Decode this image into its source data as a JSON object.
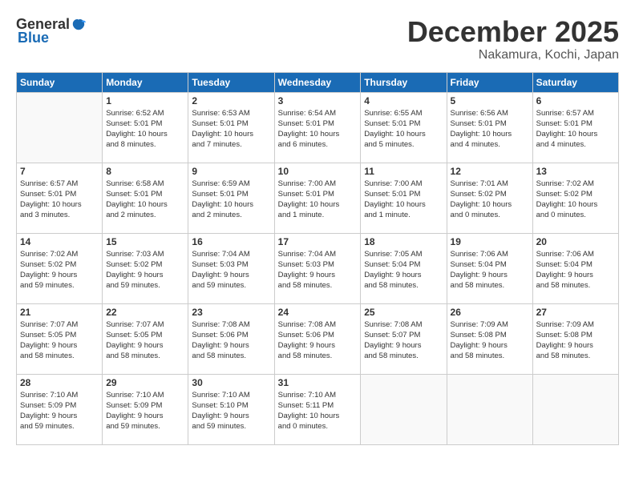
{
  "logo": {
    "general": "General",
    "blue": "Blue"
  },
  "header": {
    "month": "December 2025",
    "location": "Nakamura, Kochi, Japan"
  },
  "days_of_week": [
    "Sunday",
    "Monday",
    "Tuesday",
    "Wednesday",
    "Thursday",
    "Friday",
    "Saturday"
  ],
  "weeks": [
    [
      {
        "day": "",
        "info": ""
      },
      {
        "day": "1",
        "info": "Sunrise: 6:52 AM\nSunset: 5:01 PM\nDaylight: 10 hours\nand 8 minutes."
      },
      {
        "day": "2",
        "info": "Sunrise: 6:53 AM\nSunset: 5:01 PM\nDaylight: 10 hours\nand 7 minutes."
      },
      {
        "day": "3",
        "info": "Sunrise: 6:54 AM\nSunset: 5:01 PM\nDaylight: 10 hours\nand 6 minutes."
      },
      {
        "day": "4",
        "info": "Sunrise: 6:55 AM\nSunset: 5:01 PM\nDaylight: 10 hours\nand 5 minutes."
      },
      {
        "day": "5",
        "info": "Sunrise: 6:56 AM\nSunset: 5:01 PM\nDaylight: 10 hours\nand 4 minutes."
      },
      {
        "day": "6",
        "info": "Sunrise: 6:57 AM\nSunset: 5:01 PM\nDaylight: 10 hours\nand 4 minutes."
      }
    ],
    [
      {
        "day": "7",
        "info": "Sunrise: 6:57 AM\nSunset: 5:01 PM\nDaylight: 10 hours\nand 3 minutes."
      },
      {
        "day": "8",
        "info": "Sunrise: 6:58 AM\nSunset: 5:01 PM\nDaylight: 10 hours\nand 2 minutes."
      },
      {
        "day": "9",
        "info": "Sunrise: 6:59 AM\nSunset: 5:01 PM\nDaylight: 10 hours\nand 2 minutes."
      },
      {
        "day": "10",
        "info": "Sunrise: 7:00 AM\nSunset: 5:01 PM\nDaylight: 10 hours\nand 1 minute."
      },
      {
        "day": "11",
        "info": "Sunrise: 7:00 AM\nSunset: 5:01 PM\nDaylight: 10 hours\nand 1 minute."
      },
      {
        "day": "12",
        "info": "Sunrise: 7:01 AM\nSunset: 5:02 PM\nDaylight: 10 hours\nand 0 minutes."
      },
      {
        "day": "13",
        "info": "Sunrise: 7:02 AM\nSunset: 5:02 PM\nDaylight: 10 hours\nand 0 minutes."
      }
    ],
    [
      {
        "day": "14",
        "info": "Sunrise: 7:02 AM\nSunset: 5:02 PM\nDaylight: 9 hours\nand 59 minutes."
      },
      {
        "day": "15",
        "info": "Sunrise: 7:03 AM\nSunset: 5:02 PM\nDaylight: 9 hours\nand 59 minutes."
      },
      {
        "day": "16",
        "info": "Sunrise: 7:04 AM\nSunset: 5:03 PM\nDaylight: 9 hours\nand 59 minutes."
      },
      {
        "day": "17",
        "info": "Sunrise: 7:04 AM\nSunset: 5:03 PM\nDaylight: 9 hours\nand 58 minutes."
      },
      {
        "day": "18",
        "info": "Sunrise: 7:05 AM\nSunset: 5:04 PM\nDaylight: 9 hours\nand 58 minutes."
      },
      {
        "day": "19",
        "info": "Sunrise: 7:06 AM\nSunset: 5:04 PM\nDaylight: 9 hours\nand 58 minutes."
      },
      {
        "day": "20",
        "info": "Sunrise: 7:06 AM\nSunset: 5:04 PM\nDaylight: 9 hours\nand 58 minutes."
      }
    ],
    [
      {
        "day": "21",
        "info": "Sunrise: 7:07 AM\nSunset: 5:05 PM\nDaylight: 9 hours\nand 58 minutes."
      },
      {
        "day": "22",
        "info": "Sunrise: 7:07 AM\nSunset: 5:05 PM\nDaylight: 9 hours\nand 58 minutes."
      },
      {
        "day": "23",
        "info": "Sunrise: 7:08 AM\nSunset: 5:06 PM\nDaylight: 9 hours\nand 58 minutes."
      },
      {
        "day": "24",
        "info": "Sunrise: 7:08 AM\nSunset: 5:06 PM\nDaylight: 9 hours\nand 58 minutes."
      },
      {
        "day": "25",
        "info": "Sunrise: 7:08 AM\nSunset: 5:07 PM\nDaylight: 9 hours\nand 58 minutes."
      },
      {
        "day": "26",
        "info": "Sunrise: 7:09 AM\nSunset: 5:08 PM\nDaylight: 9 hours\nand 58 minutes."
      },
      {
        "day": "27",
        "info": "Sunrise: 7:09 AM\nSunset: 5:08 PM\nDaylight: 9 hours\nand 58 minutes."
      }
    ],
    [
      {
        "day": "28",
        "info": "Sunrise: 7:10 AM\nSunset: 5:09 PM\nDaylight: 9 hours\nand 59 minutes."
      },
      {
        "day": "29",
        "info": "Sunrise: 7:10 AM\nSunset: 5:09 PM\nDaylight: 9 hours\nand 59 minutes."
      },
      {
        "day": "30",
        "info": "Sunrise: 7:10 AM\nSunset: 5:10 PM\nDaylight: 9 hours\nand 59 minutes."
      },
      {
        "day": "31",
        "info": "Sunrise: 7:10 AM\nSunset: 5:11 PM\nDaylight: 10 hours\nand 0 minutes."
      },
      {
        "day": "",
        "info": ""
      },
      {
        "day": "",
        "info": ""
      },
      {
        "day": "",
        "info": ""
      }
    ]
  ]
}
